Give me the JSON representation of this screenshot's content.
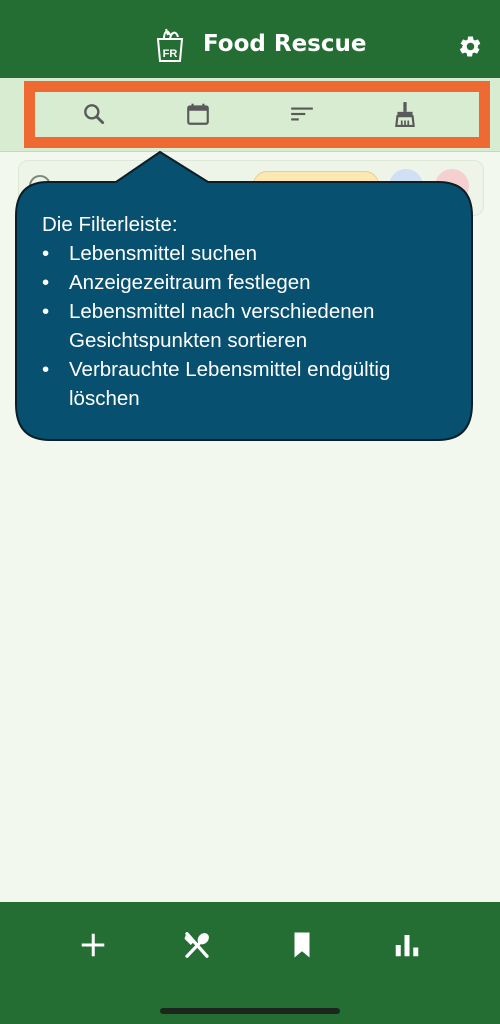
{
  "app": {
    "title": "Food Rescue",
    "logo_text": "FR"
  },
  "filterbar": {
    "icons": [
      "search-icon",
      "calendar-icon",
      "sort-icon",
      "cleanup-broom-icon"
    ]
  },
  "callout": {
    "intro": "Die Filterleiste:",
    "items": [
      "Lebensmittel suchen",
      "Anzeigezeitraum festlegen",
      "Lebensmittel nach verschiedenen Gesichtspunkten sortieren",
      "Verbrauchte Lebensmittel endgültig löschen"
    ]
  },
  "bottom_nav": {
    "icons": [
      "add-icon",
      "utensils-icon",
      "bookmark-icon",
      "bar-chart-icon"
    ]
  },
  "colors": {
    "header": "#246e33",
    "filterbar": "#d8ecd1",
    "highlight": "#ef6a32",
    "callout": "#07506f",
    "background": "#f3f8ee"
  }
}
